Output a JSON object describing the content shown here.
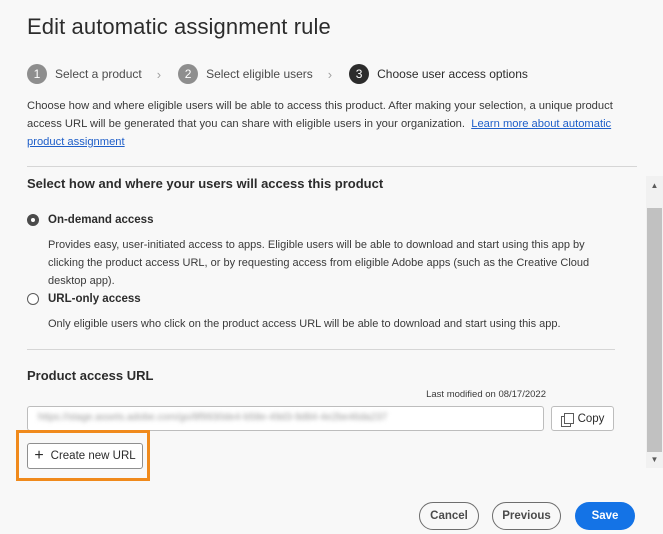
{
  "dialog": {
    "title": "Edit automatic assignment rule"
  },
  "steps": [
    {
      "number": "1",
      "label": "Select a product"
    },
    {
      "number": "2",
      "label": "Select eligible users"
    },
    {
      "number": "3",
      "label": "Choose user access options"
    }
  ],
  "intro": {
    "text": "Choose how and where eligible users will be able to access this product. After making your selection, a unique product access URL will be generated that you can share with eligible users in your organization.",
    "link": "Learn more about automatic product assignment"
  },
  "access": {
    "section_title": "Select how and where your users will access this product",
    "options": [
      {
        "label": "On-demand access",
        "checked": true,
        "description": "Provides easy, user-initiated access to apps. Eligible users will be able to download and start using this app by clicking the product access URL, or by requesting access from eligible Adobe apps (such as the Creative Cloud desktop app)."
      },
      {
        "label": "URL-only access",
        "checked": false,
        "description": "Only eligible users who click on the product access URL will be able to download and start using this app."
      }
    ]
  },
  "url_section": {
    "title": "Product access URL",
    "last_modified": "Last modified on 08/17/2022",
    "url_value": "https://stage.assets.adobe.com/go/8f9930de4-b58e-49d3-9d84-4e2be46da237",
    "copy_label": "Copy",
    "create_label": "Create new URL"
  },
  "footer": {
    "cancel": "Cancel",
    "previous": "Previous",
    "save": "Save"
  },
  "colors": {
    "accent": "#1473e6",
    "highlight": "#f08a1c",
    "link": "#1f5fc9"
  },
  "icons": {
    "copy": "copy-icon",
    "plus": "plus-icon",
    "chevron": "chevron-right-icon"
  }
}
